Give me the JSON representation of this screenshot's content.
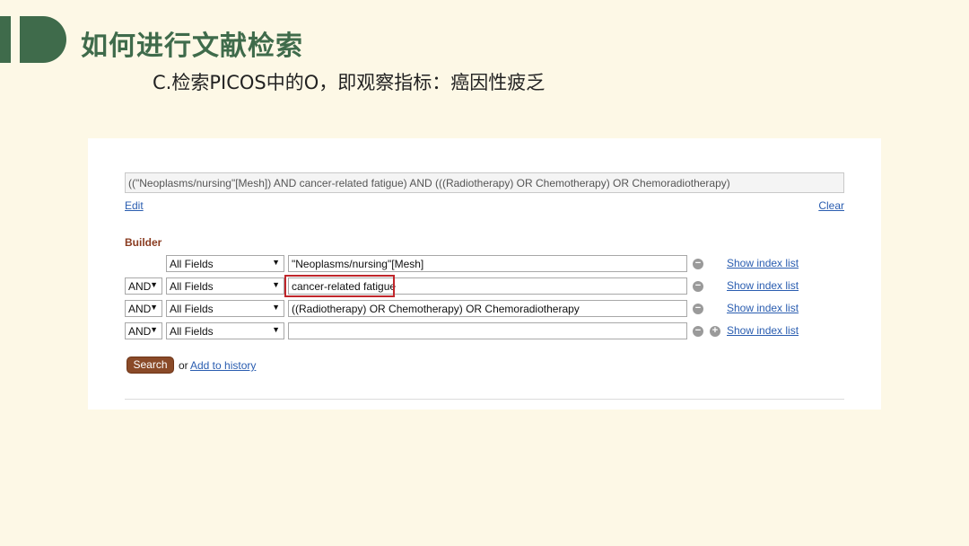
{
  "slide": {
    "title": "如何进行文献检索",
    "subtitle": "C.检索PICOS中的O，即观察指标：癌因性疲乏"
  },
  "query": {
    "text": "((\"Neoplasms/nursing\"[Mesh]) AND cancer-related fatigue) AND (((Radiotherapy) OR Chemotherapy) OR Chemoradiotherapy)",
    "edit_label": "Edit",
    "clear_label": "Clear"
  },
  "builder": {
    "label": "Builder",
    "rows": [
      {
        "operator": "",
        "field": "All Fields",
        "term": "\"Neoplasms/nursing\"[Mesh]",
        "index_link": "Show index list"
      },
      {
        "operator": "AND",
        "field": "All Fields",
        "term": "cancer-related fatigue",
        "index_link": "Show index list"
      },
      {
        "operator": "AND",
        "field": "All Fields",
        "term": "((Radiotherapy) OR Chemotherapy) OR Chemoradiotherapy",
        "index_link": "Show index list"
      },
      {
        "operator": "AND",
        "field": "All Fields",
        "term": "",
        "index_link": "Show index list"
      }
    ],
    "caret": "▼",
    "minus": "−",
    "plus": "+"
  },
  "actions": {
    "search_label": "Search",
    "or_text": "or",
    "add_history_label": "Add to history"
  },
  "colors": {
    "accent_green": "#3f6b4b",
    "builder_label": "#8a3c21",
    "search_button": "#8a4a28",
    "highlight_box": "#c0262b",
    "link": "#2a5db0"
  }
}
